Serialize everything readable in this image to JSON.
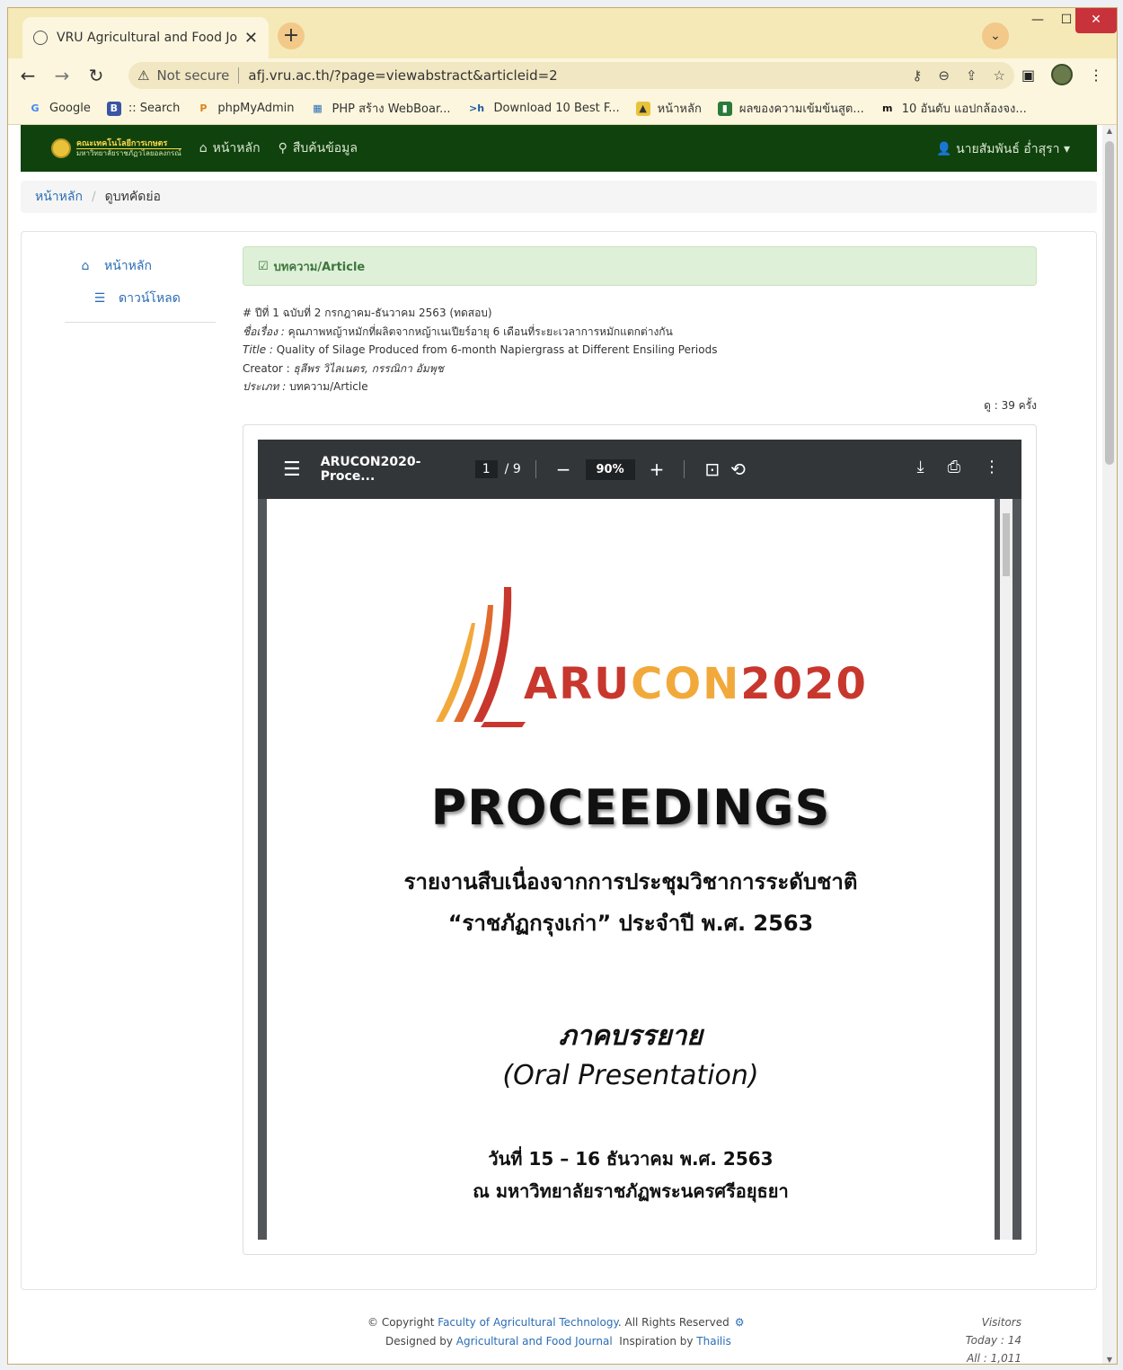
{
  "browser": {
    "tab_title": "VRU Agricultural and Food Journ",
    "url_warning": "Not secure",
    "url": "afj.vru.ac.th/?page=viewabstract&articleid=2",
    "bookmarks": [
      {
        "label": "Google",
        "icon": "G"
      },
      {
        "label": ":: Search",
        "icon": "B"
      },
      {
        "label": "phpMyAdmin",
        "icon": "P"
      },
      {
        "label": "PHP สร้าง WebBoar...",
        "icon": "▦"
      },
      {
        "label": "Download 10 Best F...",
        "icon": ">h"
      },
      {
        "label": "หน้าหลัก",
        "icon": "▲"
      },
      {
        "label": "ผลของความเข้มข้นสูต...",
        "icon": "▮"
      },
      {
        "label": "10 อันดับ แอปกล้องจง...",
        "icon": "m"
      }
    ]
  },
  "site_nav": {
    "brand_line1": "คณะเทคโนโลยีการเกษตร",
    "brand_line2": "มหาวิทยาลัยราชภัฏวไลยอลงกรณ์",
    "home": "หน้าหลัก",
    "search": "สืบค้นข้อมูล",
    "user": "นายสัมพันธ์ อ่ำสุรา"
  },
  "breadcrumb": {
    "home": "หน้าหลัก",
    "current": "ดูบทคัดย่อ"
  },
  "sidebar": {
    "home": "หน้าหลัก",
    "download": "ดาวน์โหลด"
  },
  "article": {
    "section_label": "บทความ/Article",
    "issue": "# ปีที่ 1 ฉบับที่ 2 กรกฎาคม-ธันวาคม 2563 (ทดสอบ)",
    "title_th_label": "ชื่อเรื่อง :",
    "title_th": "คุณภาพหญ้าหมักที่ผลิตจากหญ้าเนเปียร์อายุ 6 เดือนที่ระยะเวลาการหมักแตกต่างกัน",
    "title_en_label": "Title :",
    "title_en": "Quality of Silage Produced from 6-month Napiergrass at Different Ensiling Periods",
    "creator_label": "Creator :",
    "creator": "ธุลีพร วิไลเนตร, กรรณิกา อัมพุช",
    "type_label": "ประเภท :",
    "type": "บทความ/Article",
    "views": "ดู : 39 ครั้ง"
  },
  "pdf_viewer": {
    "filename": "ARUCON2020-Proce...",
    "page": "1",
    "total_pages": "/ 9",
    "zoom": "90%"
  },
  "pdf_page": {
    "logo_a": "ARU",
    "logo_c": "CON",
    "logo_y": "2020",
    "title": "PROCEEDINGS",
    "sub1": "รายงานสืบเนื่องจากการประชุมวิชาการระดับชาติ",
    "sub2": "“ราชภัฏกรุงเก่า” ประจำปี พ.ศ. 2563",
    "type_th": "ภาคบรรยาย",
    "type_en": "(Oral Presentation)",
    "date": "วันที่ 15 – 16 ธันวาคม พ.ศ. 2563",
    "place": "ณ มหาวิทยาลัยราชภัฏพระนครศรีอยุธยา"
  },
  "footer": {
    "copyright_prefix": "© Copyright",
    "faculty": "Faculty of Agricultural Technology",
    "rights": ". All Rights Reserved",
    "designed_by": "Designed by",
    "journal": "Agricultural and Food Journal",
    "inspiration_by": "Inspiration by",
    "thailis": "Thailis",
    "visitors_label": "Visitors",
    "today": "Today : 14",
    "all": "All : 1,011"
  }
}
